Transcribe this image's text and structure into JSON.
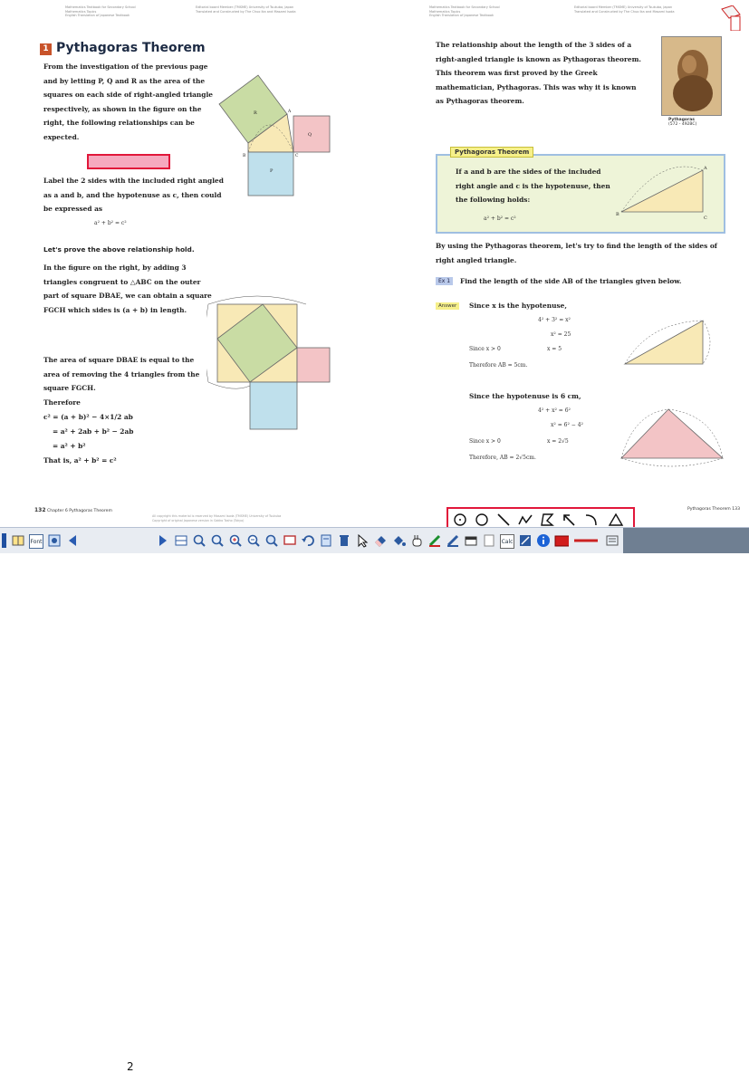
{
  "left_page": {
    "header_lines": [
      "Mathematics Textbook for Secondary School",
      "Mathematics Topics",
      "English Translation of Japanese Textbook"
    ],
    "header_center_lines": [
      "Editorial board Member (TMSME) University of Tsukuba, Japan",
      "Translated and Constructed by The Chuo Ika and Masami Isoda"
    ],
    "section_number": "1",
    "title": "Pythagoras Theorem",
    "intro": "From the investigation of the previous page and by letting P, Q and R as the area of the squares on each side of right-angled triangle respectively, as shown in the figure on the right, the following relationships can be expected.",
    "label_text": "Label the 2 sides with the included right angled as a and b, and the hypotenuse as c, then could be expressed as",
    "formula_1": "a² + b² = c²",
    "prove_heading": "Let's prove the above relationship hold.",
    "prove_text": "In the figure on the right, by adding 3 triangles congruent to △ABC on the outer part of square DBAE, we can obtain a square FGCH which sides is (a + b) in length.",
    "area_text": "The area of square DBAE is equal to the area of removing the 4 triangles from the square FGCH.",
    "therefore": "Therefore",
    "eq_1": "c² = (a + b)² − 4×1/2 ab",
    "eq_2": "= a² + 2ab + b² − 2ab",
    "eq_3": "= a² + b²",
    "eq_4": "That is, a² + b² = c²",
    "fig_labels": {
      "r": "R",
      "q": "Q",
      "p": "P",
      "a": "A",
      "b": "B",
      "c": "C"
    },
    "footer_page": "132",
    "footer_chapter": "Chapter 6 Pythagoras Theorem",
    "footer_copyright": [
      "All copyright this material is reserved by Masami Isoda (TMSME) University of Tsukuba",
      "Copyright of original Japanese version in Gakko Tosho (Tokyo)"
    ]
  },
  "right_page": {
    "header_lines": [
      "Mathematics Textbook for Secondary School",
      "Mathematics Topics",
      "English Translation of Japanese Textbook"
    ],
    "header_center_lines": [
      "Editorial board Member (TMSME) University of Tsukuba, Japan",
      "Translated and Constructed by The Chuo Ika and Masami Isoda"
    ],
    "intro": "The relationship about the length of the 3 sides of a right-angled triangle is known as Pythagoras theorem. This theorem was first proved by the Greek mathematician, Pythagoras. This was why it is known as Pythagoras theorem.",
    "portrait_caption_1": "Pythagoras",
    "portrait_caption_2": "(572 - 492BC)",
    "theorem_tag": "Pythagoras Theorem",
    "theorem_text": "If a and b are the sides of the included right angle and c is the hypotenuse, then the following holds:",
    "theorem_formula": "a² + b² = c²",
    "using_text": "By using the Pythagoras theorem, let's try to find the length of the sides of right angled triangle.",
    "example_tag": "Ex 1",
    "example_text": "Find the length of the side AB of the triangles given below.",
    "answer_tag": "Answer",
    "answer_1": "Since x is the hypotenuse,",
    "ans_eq_1": "4² + 3² = x²",
    "ans_eq_2": "x² = 25",
    "ans_since_1": "Since x > 0",
    "ans_x_1": "x = 5",
    "ans_therefore_1": "Therefore AB = 5cm.",
    "answer_2": "Since the hypotenuse is 6 cm,",
    "ans_eq_3": "4² + x² = 6²",
    "ans_eq_4": "x² = 6² − 4²",
    "ans_since_2": "Since x > 0",
    "ans_x_2": "x = 2√5",
    "ans_therefore_2": "Therefore, AB = 2√5cm.",
    "tri_labels": {
      "a": "A",
      "b": "B",
      "c": "C"
    },
    "footer_right": "Pythagoras Theorem 133"
  },
  "toolbar": {
    "page_number": "2",
    "buttons": [
      "book-icon",
      "text-icon",
      "nav-icon",
      "prev-icon",
      "next-icon",
      "thumbnails-icon",
      "zoom-icon",
      "zoom-fit-icon",
      "zoom-in-icon",
      "zoom-out-icon",
      "screen-icon",
      "undo-icon",
      "highlight-icon",
      "trash-icon",
      "pointer-icon",
      "eraser-icon",
      "hand-icon",
      "pen-icon",
      "marker-icon",
      "shape-icon",
      "window-icon",
      "calc-icon",
      "tools-icon",
      "info-icon",
      "color-icon",
      "line-icon"
    ],
    "calc_label": "Calc",
    "font_label": "Font"
  },
  "shape_tools": [
    "circle-dotted-icon",
    "circle-icon",
    "line-icon",
    "freehand-icon",
    "polygon-icon",
    "arrow-icon",
    "arc-icon",
    "triangle-icon"
  ],
  "colors": {
    "accent_red": "#e1173a",
    "title_box": "#c8532a",
    "square_green": "#c9dca4",
    "square_pink": "#f3c4c6",
    "square_blue": "#bfe0ec",
    "triangle_yellow": "#f8e9b6",
    "theorem_bg": "#eef4d8"
  }
}
